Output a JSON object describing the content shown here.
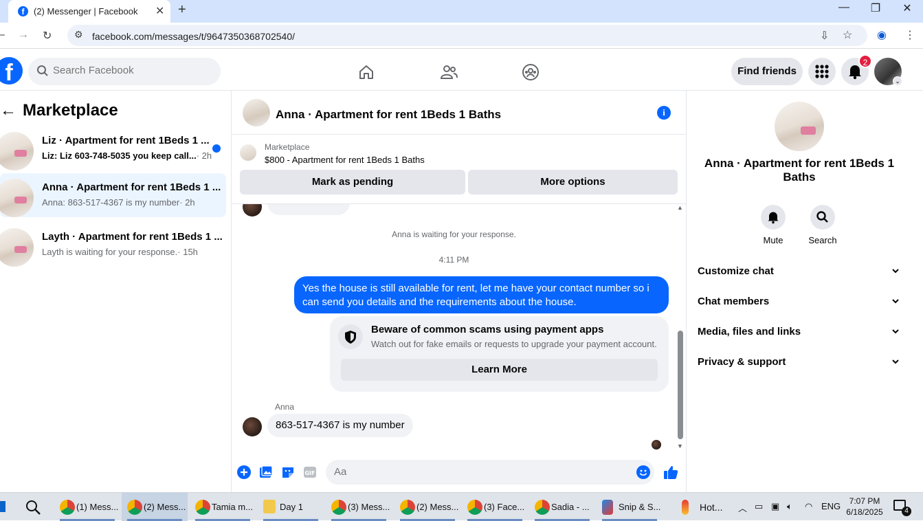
{
  "browser": {
    "tab_title": "(2) Messenger | Facebook",
    "url": "facebook.com/messages/t/9647350368702540/"
  },
  "header": {
    "search_placeholder": "Search Facebook",
    "find_friends": "Find friends",
    "notif_count": "2"
  },
  "sidebar": {
    "title": "Marketplace",
    "conversations": [
      {
        "name": "Liz · Apartment for rent 1Beds 1 ...",
        "preview": "Liz: Liz 603-748-5035 you keep call...",
        "time": "· 2h",
        "unread": true
      },
      {
        "name": "Anna · Apartment for rent 1Beds 1 ...",
        "preview": "Anna: 863-517-4367 is my number",
        "time": "· 2h",
        "unread": false
      },
      {
        "name": "Layth · Apartment for rent 1Beds 1 ...",
        "preview": "Layth is waiting for your response.",
        "time": "· 15h",
        "unread": false
      }
    ]
  },
  "chat": {
    "title": "Anna · Apartment for rent 1Beds 1 Baths",
    "marketplace_label": "Marketplace",
    "listing": "$800 - Apartment for rent 1Beds 1 Baths",
    "mark_pending": "Mark as pending",
    "more_options": "More options",
    "waiting_note": "Anna is waiting for your response.",
    "timestamp": "4:11 PM",
    "outgoing_message": "Yes the house is still available for rent, let me have your contact number so i can send you details and the requirements about the house.",
    "scam_title": "Beware of common scams using payment apps",
    "scam_desc": "Watch out for fake emails or requests to upgrade your payment account.",
    "learn_more": "Learn More",
    "sender_name": "Anna",
    "incoming_message": "863-517-4367 is my number",
    "composer_placeholder": "Aa"
  },
  "info_panel": {
    "title": "Anna · Apartment for rent 1Beds 1 Baths",
    "mute": "Mute",
    "search": "Search",
    "sections": [
      "Customize chat",
      "Chat members",
      "Media, files and links",
      "Privacy & support"
    ]
  },
  "taskbar": {
    "items": [
      {
        "label": "(1) Mess...",
        "icon": "chrome-icon"
      },
      {
        "label": "(2) Mess...",
        "icon": "chrome-icon"
      },
      {
        "label": "Tamia m...",
        "icon": "chrome-icon"
      },
      {
        "label": "Day 1",
        "icon": "folder-icon"
      },
      {
        "label": "(3) Mess...",
        "icon": "chrome-icon"
      },
      {
        "label": "(2) Mess...",
        "icon": "chrome-icon"
      },
      {
        "label": "(3) Face...",
        "icon": "chrome-icon"
      },
      {
        "label": "Sadia - ...",
        "icon": "chrome-icon"
      },
      {
        "label": "Snip & S...",
        "icon": "snip-icon"
      },
      {
        "label": "Hot...",
        "icon": "thermometer-icon"
      }
    ],
    "lang": "ENG",
    "time": "7:07 PM",
    "date": "6/18/2025",
    "notif_count": "4"
  },
  "colors": {
    "fb_blue": "#0866ff",
    "active_conv_bg": "#ebf5ff",
    "badge_red": "#e41e3f"
  }
}
